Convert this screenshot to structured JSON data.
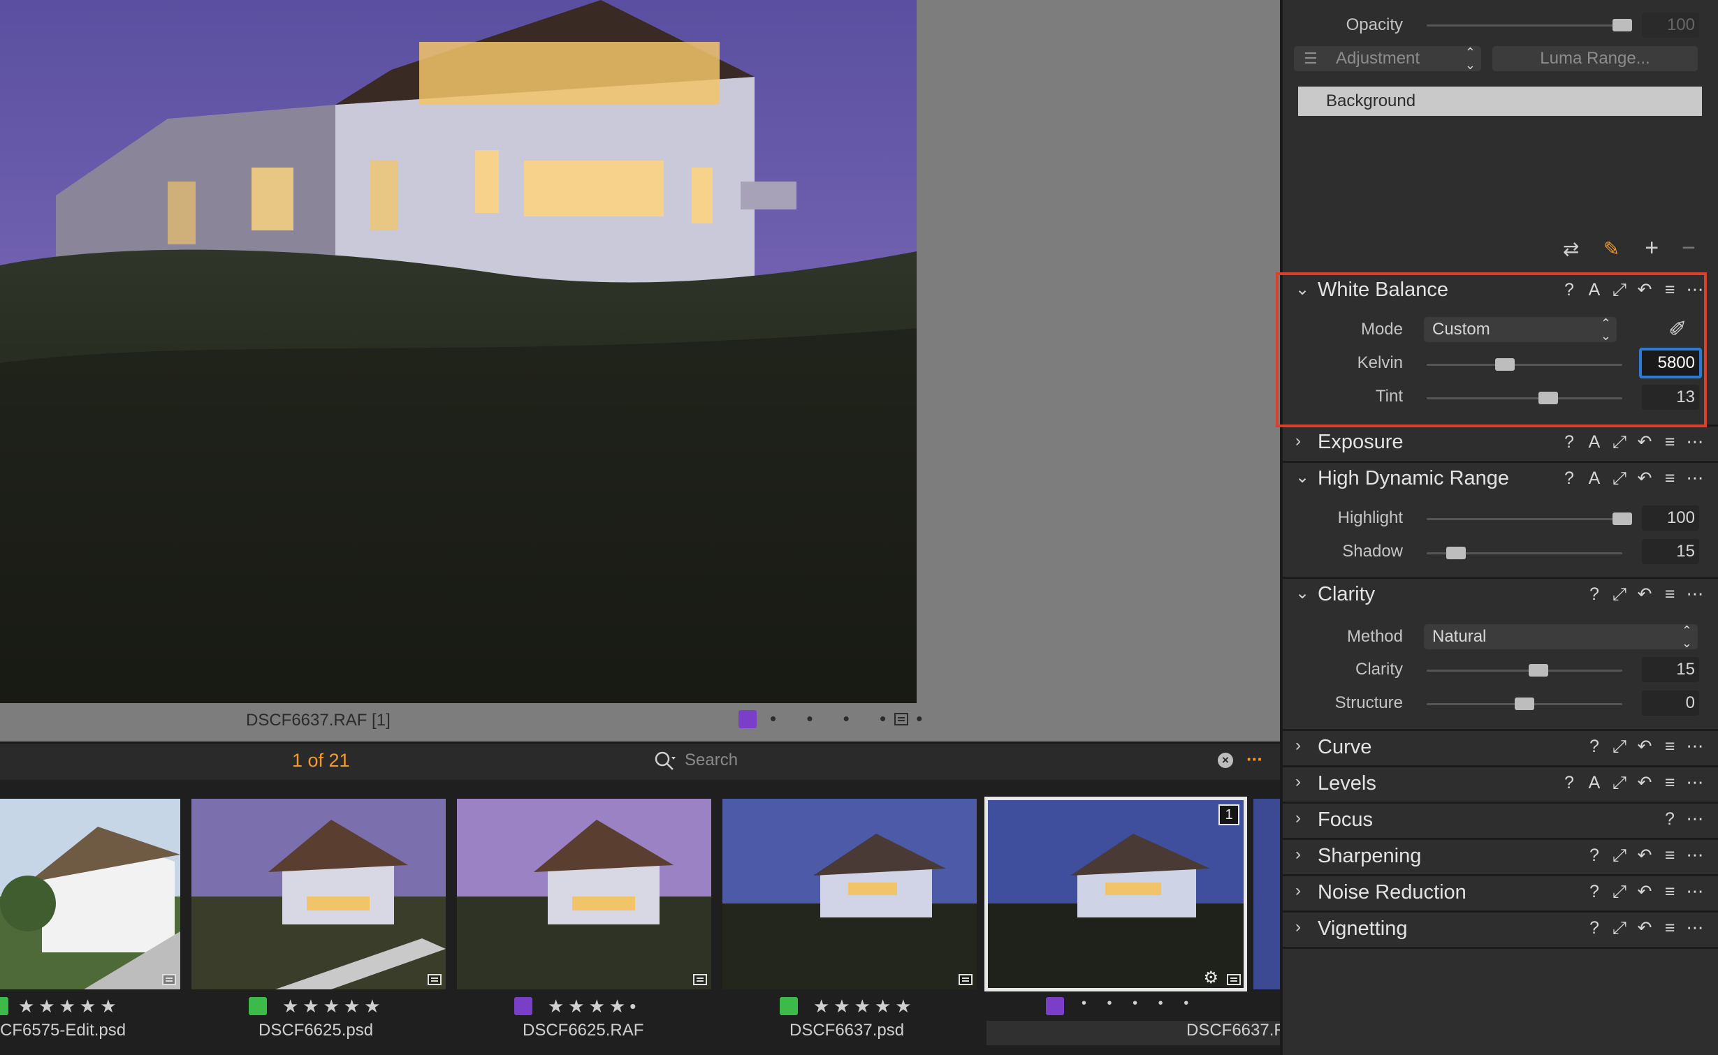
{
  "viewer": {
    "filename": "DSCF6637.RAF [1]",
    "color_tag": "#7a3fc9",
    "rating_dots": "• • • • •"
  },
  "browser": {
    "count": "1 of 21",
    "search_placeholder": "Search"
  },
  "filmstrip": [
    {
      "name": "CF6575-Edit.psd",
      "tag": "#3dbb4a",
      "rating": "★★★★★"
    },
    {
      "name": "DSCF6625.psd",
      "tag": "#3dbb4a",
      "rating": "★★★★★"
    },
    {
      "name": "DSCF6625.RAF",
      "tag": "#7a3fc9",
      "rating": "★★★★•"
    },
    {
      "name": "DSCF6637.psd",
      "tag": "#3dbb4a",
      "rating": "★★★★★"
    },
    {
      "name": "DSCF6637.R",
      "tag": "#7a3fc9",
      "rating": "• • • • •",
      "badge": "1"
    }
  ],
  "layers": {
    "opacity_label": "Opacity",
    "opacity_value": "100",
    "opacity_level": 1.0,
    "adjustment_label": "Adjustment",
    "luma_range_label": "Luma Range...",
    "background_layer": "Background"
  },
  "white_balance": {
    "title": "White Balance",
    "mode_label": "Mode",
    "mode_value": "Custom",
    "kelvin_label": "Kelvin",
    "kelvin_value": "5800",
    "kelvin_level": 0.4,
    "tint_label": "Tint",
    "tint_value": "13",
    "tint_level": 0.62
  },
  "exposure": {
    "title": "Exposure"
  },
  "hdr": {
    "title": "High Dynamic Range",
    "highlight_label": "Highlight",
    "highlight_value": "100",
    "highlight_level": 1.0,
    "shadow_label": "Shadow",
    "shadow_value": "15",
    "shadow_level": 0.15
  },
  "clarity": {
    "title": "Clarity",
    "method_label": "Method",
    "method_value": "Natural",
    "clarity_label": "Clarity",
    "clarity_value": "15",
    "clarity_level": 0.57,
    "structure_label": "Structure",
    "structure_value": "0",
    "structure_level": 0.5
  },
  "collapsed_tools": {
    "curve": "Curve",
    "levels": "Levels",
    "focus": "Focus",
    "sharpening": "Sharpening",
    "noise_reduction": "Noise Reduction",
    "vignetting": "Vignetting"
  },
  "icons": {
    "help": "?",
    "auto": "A",
    "copy_apply": "⤢",
    "reset": "↶",
    "presets": "≡",
    "more": "•••"
  },
  "colors": {
    "accent_orange": "#f39a2b",
    "highlight_red": "#d9412c",
    "focus_blue": "#2d7ad6"
  }
}
